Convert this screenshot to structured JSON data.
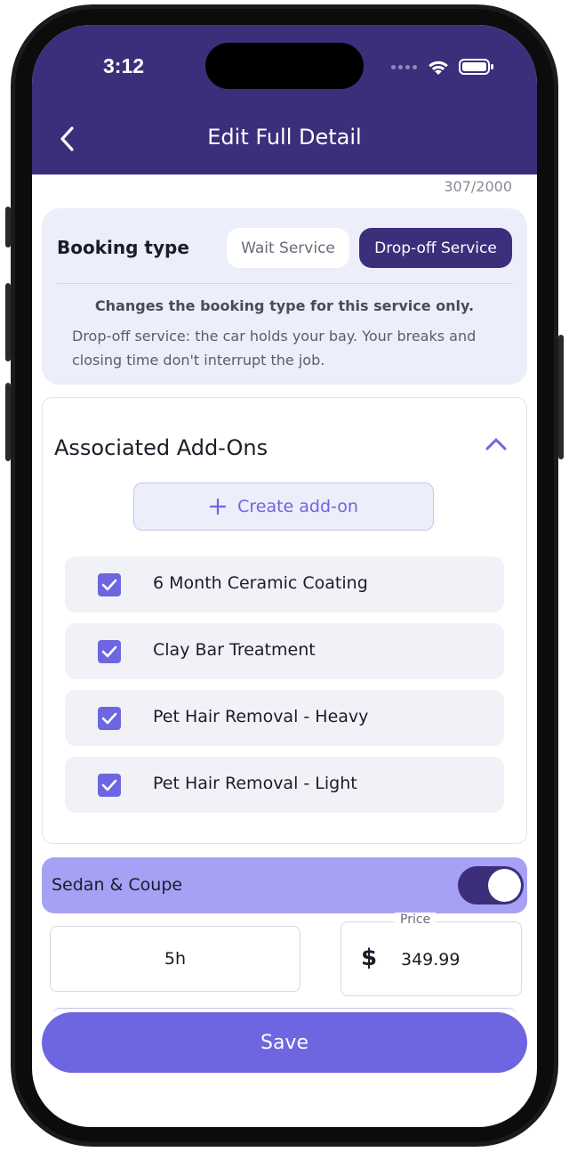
{
  "status_bar": {
    "time": "3:12"
  },
  "header": {
    "title": "Edit Full Detail",
    "back_icon": "chevron-left-icon"
  },
  "description_counter": "307/2000",
  "booking": {
    "label": "Booking type",
    "options": [
      "Wait Service",
      "Drop-off Service"
    ],
    "selected": "Drop-off Service",
    "note_bold": "Changes the booking type for this service only.",
    "note": "Drop-off service: the car holds your bay. Your breaks and closing time don't interrupt the job."
  },
  "addons": {
    "title": "Associated Add-Ons",
    "collapse_icon": "chevron-up-icon",
    "create_label": "Create add-on",
    "create_icon": "plus-icon",
    "items": [
      {
        "label": "6 Month Ceramic Coating",
        "checked": true
      },
      {
        "label": "Clay Bar Treatment",
        "checked": true
      },
      {
        "label": "Pet Hair Removal - Heavy",
        "checked": true
      },
      {
        "label": "Pet Hair Removal - Light",
        "checked": true
      }
    ]
  },
  "vehicle": {
    "label": "Sedan & Coupe",
    "enabled": true,
    "duration": "5h",
    "price_label": "Price",
    "currency_symbol": "$",
    "price": "349.99"
  },
  "save_label": "Save",
  "colors": {
    "header_bg": "#3b2f7c",
    "accent": "#6d66e0",
    "vehicle_bar": "#a7a1f5",
    "card_bg": "#eceefa"
  }
}
